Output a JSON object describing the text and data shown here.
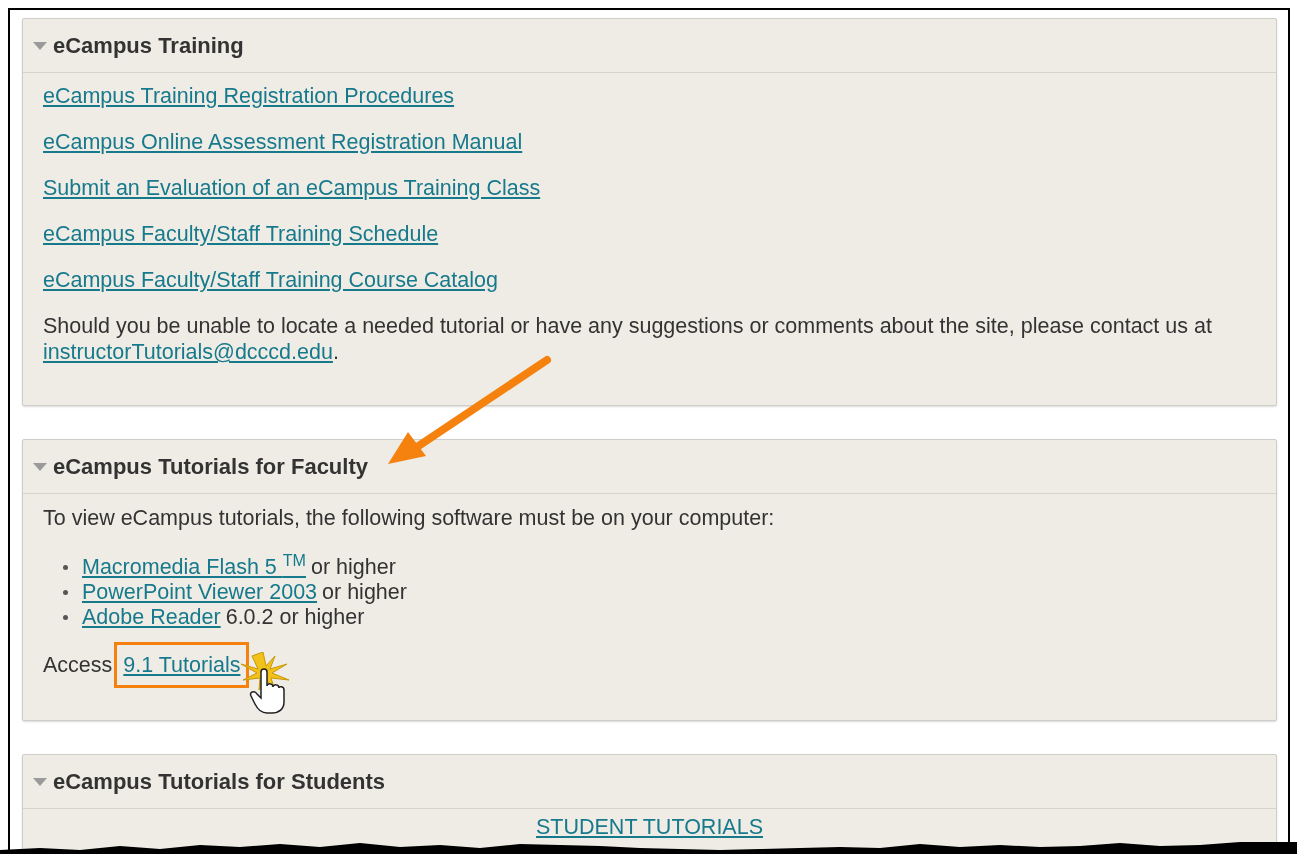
{
  "sections": [
    {
      "title": "eCampus Training",
      "expanded": true,
      "blocks": [
        {
          "kind": "link",
          "link": "eCampus Training Registration Procedures"
        },
        {
          "kind": "link",
          "link": "eCampus Online Assessment Registration Manual"
        },
        {
          "kind": "link",
          "link": "Submit an Evaluation of an eCampus Training Class"
        },
        {
          "kind": "link",
          "link": "eCampus Faculty/Staff Training Schedule"
        },
        {
          "kind": "link",
          "link": "eCampus Faculty/Staff Training Course Catalog"
        },
        {
          "kind": "paragraph",
          "text": "Should you be unable to locate a needed tutorial or have any suggestions or comments about the site, please contact us at",
          "link": "instructorTutorials@dcccd.edu",
          "after": "."
        }
      ]
    },
    {
      "title": "eCampus Tutorials for Faculty",
      "expanded": true,
      "blocks": [
        {
          "kind": "text",
          "text": "To view eCampus tutorials, the following software must be on your computer:"
        },
        {
          "kind": "list",
          "items": [
            {
              "link": "Macromedia Flash 5 $^{TM}$",
              "text": "or higher"
            },
            {
              "link": "PowerPoint Viewer 2003",
              "text": "or higher"
            },
            {
              "link": "Adobe Reader",
              "text": "6.0.2 or higher"
            }
          ]
        },
        {
          "kind": "access",
          "text": "Access",
          "link": "9.1 Tutorials",
          "highlighted": true
        }
      ]
    },
    {
      "title": "eCampus Tutorials for Students",
      "expanded": true,
      "blocks": [
        {
          "kind": "center",
          "link": "STUDENT TUTORIALS"
        }
      ]
    }
  ]
}
